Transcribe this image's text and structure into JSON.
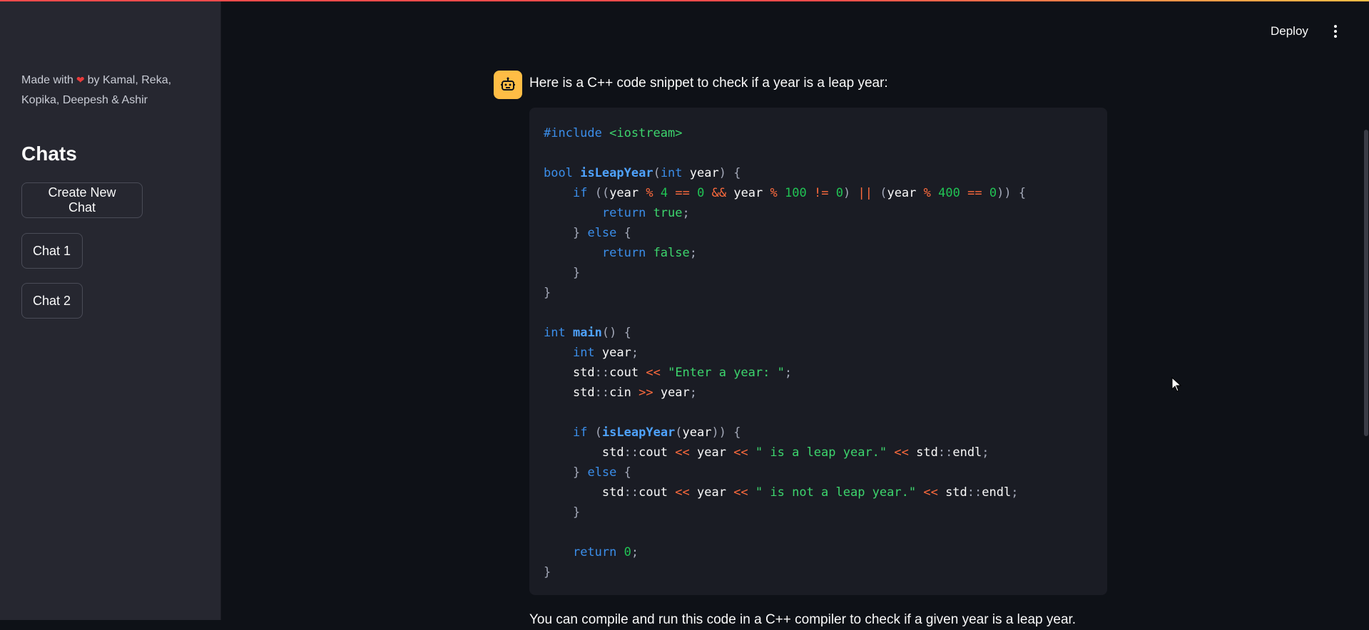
{
  "sidebar": {
    "made_with_prefix": "Made with",
    "heart_icon": "heart-icon",
    "made_with_suffix": "by Kamal, Reka, Kopika, Deepesh & Ashir",
    "heading": "Chats",
    "buttons": [
      {
        "label": "Create New Chat"
      },
      {
        "label": "Chat 1"
      },
      {
        "label": "Chat 2"
      }
    ]
  },
  "header": {
    "deploy_label": "Deploy",
    "menu_icon": "more-vertical-icon"
  },
  "message": {
    "avatar_icon": "robot-icon",
    "intro": "Here is a C++ code snippet to check if a year is a leap year:",
    "code_lines": [
      "#include <iostream>",
      "",
      "bool isLeapYear(int year) {",
      "    if ((year % 4 == 0 && year % 100 != 0) || (year % 400 == 0)) {",
      "        return true;",
      "    } else {",
      "        return false;",
      "    }",
      "}",
      "",
      "int main() {",
      "    int year;",
      "    std::cout << \"Enter a year: \";",
      "    std::cin >> year;",
      "",
      "    if (isLeapYear(year)) {",
      "        std::cout << year << \" is a leap year.\" << std::endl;",
      "    } else {",
      "        std::cout << year << \" is not a leap year.\" << std::endl;",
      "    }",
      "",
      "    return 0;",
      "}"
    ],
    "trailing_text": "You can compile and run this code in a C++ compiler to check if a given year is a leap year."
  },
  "colors": {
    "background": "#0e1117",
    "sidebar": "#262730",
    "code_background": "#1a1c24",
    "avatar": "#ffbd45",
    "top_accent": "#ff4b4b"
  }
}
